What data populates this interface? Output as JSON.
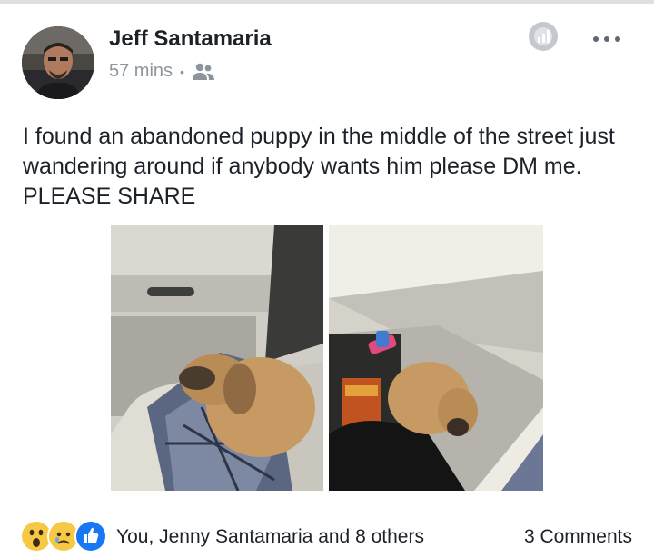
{
  "post": {
    "author_name": "Jeff Santamaria",
    "time": "57 mins",
    "separator": "•",
    "audience_icon": "friends-icon",
    "text": "I found an abandoned puppy in the middle of the street just wandering around if anybody wants him please DM me. PLEASE SHARE",
    "photos": [
      {
        "description_icon": "puppy-on-car-seat-photo"
      },
      {
        "description_icon": "puppy-on-car-floor-photo"
      }
    ]
  },
  "reactions": {
    "icons": [
      "wow-icon",
      "sad-icon",
      "like-icon"
    ],
    "summary": "You, Jenny Santamaria and 8 others",
    "comments": "3 Comments"
  },
  "colors": {
    "meta": "#8d949e",
    "like_blue": "#1877f2",
    "emoji_yellow": "#f7c844"
  }
}
